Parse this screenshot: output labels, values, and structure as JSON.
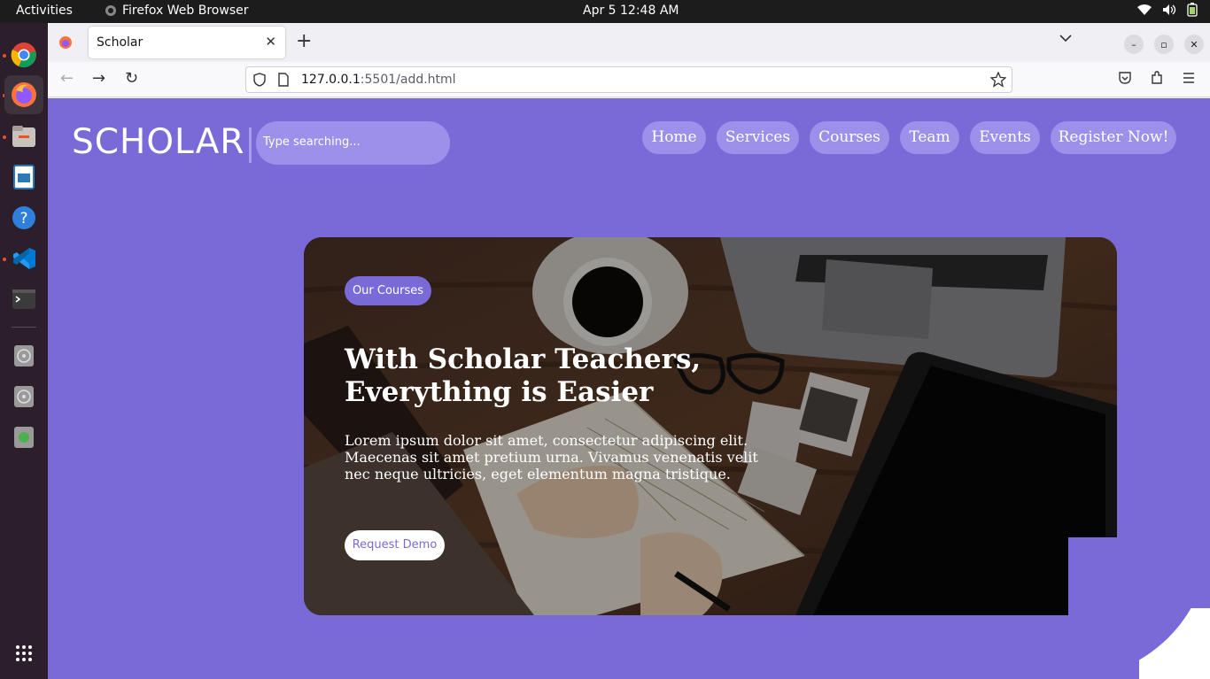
{
  "system": {
    "activities": "Activities",
    "app_name": "Firefox Web Browser",
    "clock": "Apr 5  12:48 AM"
  },
  "dock": {
    "items": [
      "chrome-icon",
      "firefox-icon",
      "files-icon",
      "writer-icon",
      "help-icon",
      "vscode-icon",
      "terminal-icon",
      "disc-icon",
      "disc-icon",
      "trash-icon",
      "apps-grid-icon"
    ]
  },
  "browser": {
    "tab_title": "Scholar",
    "url_host": "127.0.0.1",
    "url_rest": ":5501/add.html"
  },
  "site": {
    "logo": "SCHOLAR",
    "search_placeholder": "Type searching...",
    "nav": [
      "Home",
      "Services",
      "Courses",
      "Team",
      "Events",
      "Register Now!"
    ],
    "hero": {
      "tag": "Our Courses",
      "title": "With Scholar Teachers, Everything is Easier",
      "text": "Lorem ipsum dolor sit amet, consectetur adipiscing elit. Maecenas sit amet pretium urna. Vivamus venenatis velit nec neque ultricies, eget elementum magna tristique.",
      "button": "Request Demo"
    },
    "colors": {
      "accent": "#7a6ad8",
      "pill": "#9d90ea"
    }
  }
}
